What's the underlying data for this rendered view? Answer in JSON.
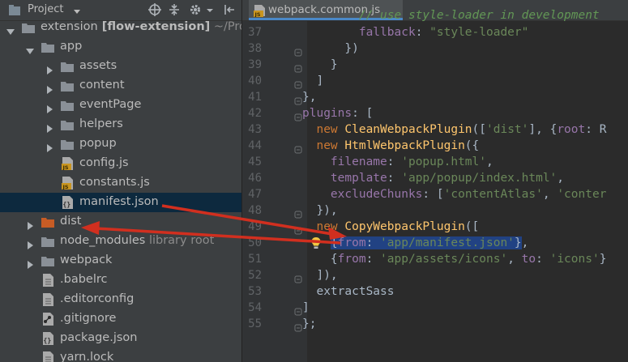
{
  "project_panel": {
    "title": "Project",
    "tree": [
      {
        "name": "extension",
        "suffix_bold": "[flow-extension]",
        "hint": "~/Proj",
        "kind": "folder-dark",
        "depth": 0,
        "expanded": true
      },
      {
        "name": "app",
        "kind": "folder",
        "depth": 1,
        "expanded": true
      },
      {
        "name": "assets",
        "kind": "folder",
        "depth": 2,
        "expanded": false
      },
      {
        "name": "content",
        "kind": "folder",
        "depth": 2,
        "expanded": false
      },
      {
        "name": "eventPage",
        "kind": "folder",
        "depth": 2,
        "expanded": false
      },
      {
        "name": "helpers",
        "kind": "folder",
        "depth": 2,
        "expanded": false
      },
      {
        "name": "popup",
        "kind": "folder",
        "depth": 2,
        "expanded": false
      },
      {
        "name": "config.js",
        "kind": "js",
        "depth": 2
      },
      {
        "name": "constants.js",
        "kind": "js",
        "depth": 2
      },
      {
        "name": "manifest.json",
        "kind": "json",
        "depth": 2,
        "selected": true
      },
      {
        "name": "dist",
        "kind": "folder-orange",
        "depth": 1,
        "expanded": false
      },
      {
        "name": "node_modules",
        "hint": "library root",
        "kind": "folder",
        "depth": 1,
        "expanded": false
      },
      {
        "name": "webpack",
        "kind": "folder",
        "depth": 1,
        "expanded": false
      },
      {
        "name": ".babelrc",
        "kind": "file",
        "depth": 1
      },
      {
        "name": ".editorconfig",
        "kind": "file",
        "depth": 1
      },
      {
        "name": ".gitignore",
        "kind": "git",
        "depth": 1
      },
      {
        "name": "package.json",
        "kind": "json",
        "depth": 1
      },
      {
        "name": "yarn.lock",
        "kind": "file",
        "depth": 1
      }
    ]
  },
  "editor": {
    "tab_label": "webpack.common.js",
    "first_line_number": 37,
    "lines": [
      {
        "n": "37",
        "tokens": [
          {
            "t": "        fallback",
            "c": "p"
          },
          {
            "t": ": "
          },
          {
            "t": "\"style-loader\"",
            "c": "s"
          }
        ]
      },
      {
        "n": "38",
        "tokens": [
          {
            "t": "      })"
          }
        ]
      },
      {
        "n": "39",
        "tokens": [
          {
            "t": "    }"
          }
        ]
      },
      {
        "n": "40",
        "tokens": [
          {
            "t": "  ]"
          }
        ]
      },
      {
        "n": "41",
        "tokens": [
          {
            "t": "},"
          }
        ]
      },
      {
        "n": "42",
        "tokens": [
          {
            "t": "plugins",
            "c": "p"
          },
          {
            "t": ": ["
          }
        ]
      },
      {
        "n": "43",
        "tokens": [
          {
            "t": "  "
          },
          {
            "t": "new ",
            "c": "k"
          },
          {
            "t": "CleanWebpackPlugin",
            "c": "f"
          },
          {
            "t": "(["
          },
          {
            "t": "'dist'",
            "c": "s"
          },
          {
            "t": "], {"
          },
          {
            "t": "root",
            "c": "p"
          },
          {
            "t": ": R"
          }
        ]
      },
      {
        "n": "44",
        "tokens": [
          {
            "t": "  "
          },
          {
            "t": "new ",
            "c": "k"
          },
          {
            "t": "HtmlWebpackPlugin",
            "c": "f"
          },
          {
            "t": "({"
          }
        ]
      },
      {
        "n": "45",
        "tokens": [
          {
            "t": "    "
          },
          {
            "t": "filename",
            "c": "p"
          },
          {
            "t": ": "
          },
          {
            "t": "'popup.html'",
            "c": "s"
          },
          {
            "t": ","
          }
        ]
      },
      {
        "n": "46",
        "tokens": [
          {
            "t": "    "
          },
          {
            "t": "template",
            "c": "p"
          },
          {
            "t": ": "
          },
          {
            "t": "'app/popup/index.html'",
            "c": "s"
          },
          {
            "t": ","
          }
        ]
      },
      {
        "n": "47",
        "tokens": [
          {
            "t": "    "
          },
          {
            "t": "excludeChunks",
            "c": "p"
          },
          {
            "t": ": ["
          },
          {
            "t": "'contentAtlas'",
            "c": "s"
          },
          {
            "t": ", "
          },
          {
            "t": "'conter",
            "c": "s"
          }
        ]
      },
      {
        "n": "48",
        "tokens": [
          {
            "t": "  }),"
          }
        ]
      },
      {
        "n": "49",
        "tokens": [
          {
            "t": "  "
          },
          {
            "t": "new ",
            "c": "k"
          },
          {
            "t": "CopyWebpackPlugin",
            "c": "f"
          },
          {
            "t": "(["
          }
        ]
      },
      {
        "n": "50",
        "tokens": [
          {
            "t": "    "
          },
          {
            "t": "{",
            "sel": true
          },
          {
            "t": "from",
            "c": "p",
            "sel": true
          },
          {
            "t": ": ",
            "sel": true
          },
          {
            "t": "'app/manifest.json'",
            "c": "s",
            "sel": true
          },
          {
            "t": "}",
            "sel": true
          },
          {
            "t": ","
          }
        ]
      },
      {
        "n": "51",
        "tokens": [
          {
            "t": "    {"
          },
          {
            "t": "from",
            "c": "p"
          },
          {
            "t": ": "
          },
          {
            "t": "'app/assets/icons'",
            "c": "s"
          },
          {
            "t": ", "
          },
          {
            "t": "to",
            "c": "p"
          },
          {
            "t": ": "
          },
          {
            "t": "'icons'",
            "c": "s"
          },
          {
            "t": "}"
          }
        ]
      },
      {
        "n": "52",
        "tokens": [
          {
            "t": "  ]),"
          }
        ]
      },
      {
        "n": "53",
        "tokens": [
          {
            "t": "  extractSass"
          }
        ]
      },
      {
        "n": "54",
        "tokens": [
          {
            "t": "]"
          }
        ]
      },
      {
        "n": "55",
        "tokens": [
          {
            "t": "};"
          }
        ]
      }
    ],
    "partial_top_line": "// use style-loader in development"
  },
  "colors": {
    "annotation_arrow": "#d12f1f",
    "selection": "#214283"
  }
}
